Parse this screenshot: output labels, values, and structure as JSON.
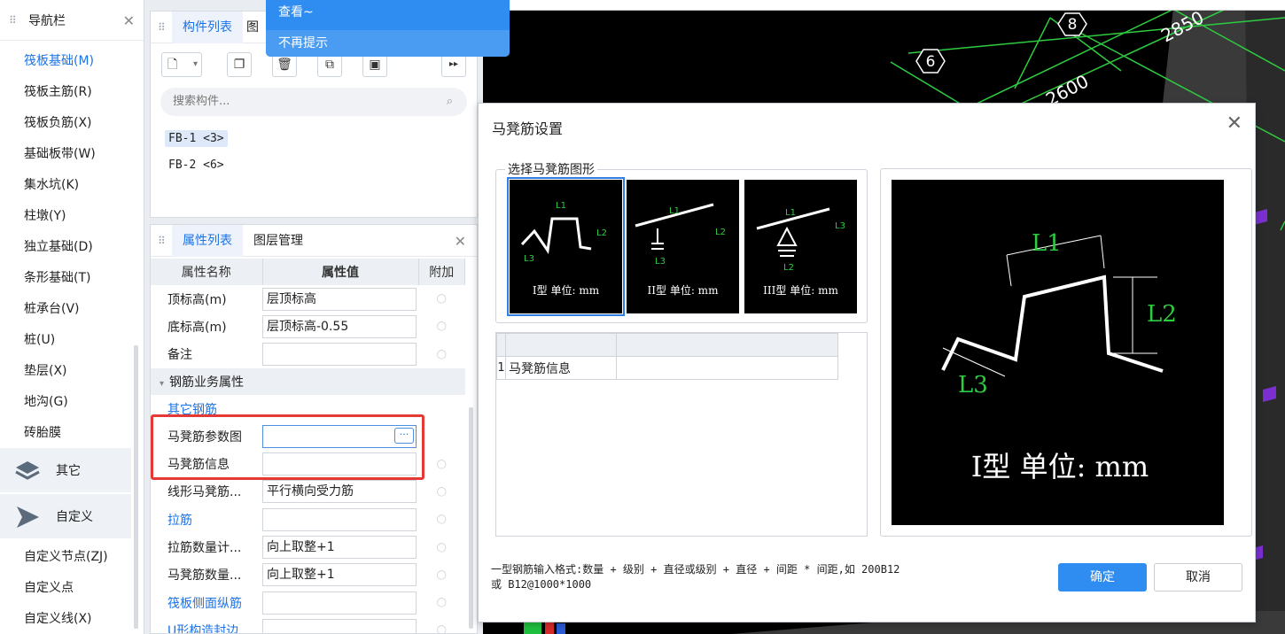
{
  "nav": {
    "title": "导航栏",
    "items": [
      "筏板基础(M)",
      "筏板主筋(R)",
      "筏板负筋(X)",
      "基础板带(W)",
      "集水坑(K)",
      "柱墩(Y)",
      "独立基础(D)",
      "条形基础(T)",
      "桩承台(V)",
      "桩(U)",
      "垫层(X)",
      "地沟(G)",
      "砖胎膜"
    ],
    "groups": [
      "其它",
      "自定义"
    ],
    "sub_items": [
      "自定义节点(ZJ)",
      "自定义点",
      "自定义线(X)"
    ]
  },
  "component_panel": {
    "tab": "构件列表",
    "tab2_fragment": "图",
    "search_placeholder": "搜索构件...",
    "items": [
      "FB-1 <3>",
      "FB-2 <6>"
    ]
  },
  "tooltip_menu": {
    "item1": "查看~",
    "item2": "不再提示"
  },
  "property_panel": {
    "tabs": [
      "属性列表",
      "图层管理"
    ],
    "headers": [
      "属性名称",
      "属性值",
      "附加"
    ],
    "rows": [
      {
        "name": "顶标高(m)",
        "value": "层顶标高"
      },
      {
        "name": "底标高(m)",
        "value": "层顶标高-0.55"
      },
      {
        "name": "备注",
        "value": ""
      }
    ],
    "section": "钢筋业务属性",
    "rows2": [
      {
        "name": "其它钢筋",
        "value": ""
      },
      {
        "name": "马凳筋参数图",
        "value": ""
      },
      {
        "name": "马凳筋信息",
        "value": ""
      },
      {
        "name": "线形马凳筋...",
        "value": "平行横向受力筋"
      },
      {
        "name": "拉筋",
        "value": ""
      },
      {
        "name": "拉筋数量计...",
        "value": "向上取整+1"
      },
      {
        "name": "马凳筋数量...",
        "value": "向上取整+1"
      },
      {
        "name": "筏板侧面纵筋",
        "value": ""
      },
      {
        "name": "U形构造封边...",
        "value": ""
      }
    ]
  },
  "cad": {
    "labels": [
      "8",
      "6",
      "2850",
      "2600"
    ],
    "grid_color": "#2ecc40"
  },
  "dialog": {
    "title": "马凳筋设置",
    "group_label": "选择马凳筋图形",
    "shapes": [
      "I型 单位: mm",
      "II型 单位: mm",
      "III型 单位: mm"
    ],
    "shape_dims": [
      "L1",
      "L2",
      "L3"
    ],
    "grid_row_num": "1",
    "grid_row_label": "马凳筋信息",
    "preview_caption": "I型 单位: mm",
    "hint_line1": "一型钢筋输入格式:数量 + 级别 + 直径或级别 + 直径 + 间距 * 间距,如 200B12",
    "hint_line2": "或 B12@1000*1000",
    "ok": "确定",
    "cancel": "取消"
  },
  "colors": {
    "accent": "#1a73e8",
    "primary_button": "#2f8cf0",
    "highlight": "#e53935"
  }
}
